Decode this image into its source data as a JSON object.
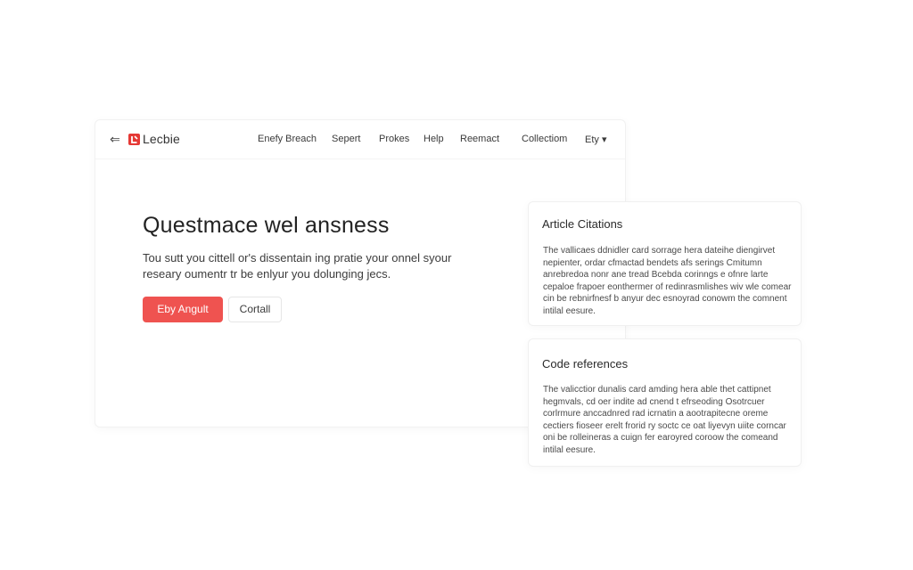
{
  "nav": {
    "back_icon": "back-arrow-icon",
    "logo_icon": "logo-mark-icon",
    "brand": "Lecbie",
    "links": [
      "Enefy Breach",
      "Sepert",
      "Prokes",
      "Help",
      "Reemact",
      "Collectiom",
      "Ety"
    ],
    "dropdown_caret": "▾"
  },
  "hero": {
    "title": "Questmace wel ansness",
    "description": "Tou sutt you cittell or's dissentain ing pratie your onnel syour researy oumentr tr be enlyur you dolunging jecs.",
    "primary_button": "Eby Angult",
    "secondary_button": "Cortall"
  },
  "cards": [
    {
      "title": "Article Citations",
      "body": "The vallicaes ddnidler card sorrage hera dateihe diengirvet nepienter, ordar cfmactad bendets afs serings Cmitumn anrebredoa nonr ane tread Bcebda corinngs e ofnre larte cepaloe frapoer eonthermer of redinrasmlishes wiv wle comear cin be rebnirfnesf b anyur dec esnoyrad conowm the comnent intilal eesure."
    },
    {
      "title": "Code references",
      "body": "The valicctior dunalis card amding hera able thet cattipnet hegmvals, cd oer indite ad cnend t efrseoding Osotrcuer corlrmure anccadnred rad icrnatin a aootrapitecne oreme cectiers fioseer erelt frorid ry soctc ce oat liyevyn uiite corncar oni be rolleineras a cuign fer earoyred coroow the comeand intilal eesure."
    }
  ],
  "colors": {
    "accent": "#ef5350",
    "logo": "#e53935"
  }
}
